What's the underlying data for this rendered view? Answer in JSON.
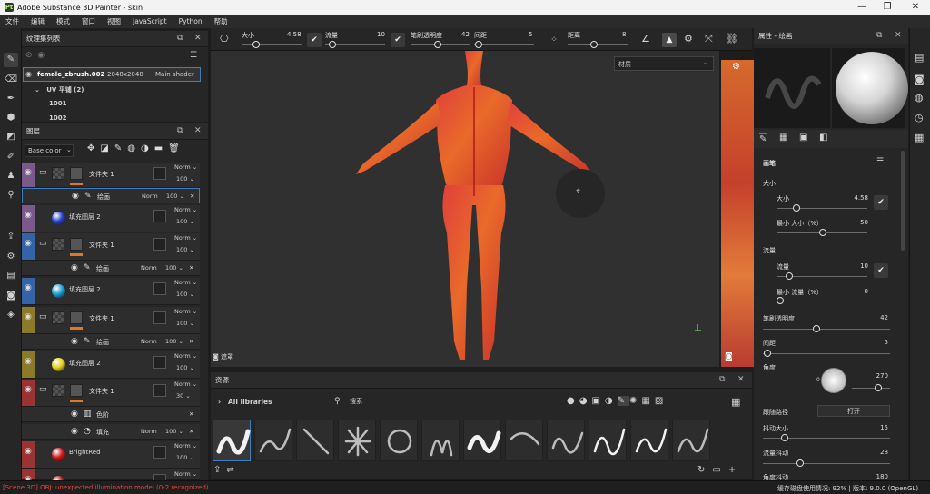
{
  "app": {
    "title": "Adobe Substance 3D Painter - skin"
  },
  "menu": [
    "文件",
    "编辑",
    "模式",
    "窗口",
    "视图",
    "JavaScript",
    "Python",
    "帮助"
  ],
  "texture_set": {
    "title": "纹理集列表",
    "item_name": "female_zbrush.002",
    "item_res": "2048x2048",
    "item_shader": "Main shader",
    "uv_label": "UV 平铺 (2)",
    "uv_tiles": [
      "1001",
      "1002"
    ]
  },
  "layers_panel": {
    "title": "图层",
    "channel": "Base color",
    "layers": [
      {
        "name": "文件夹 1",
        "blend": "Norm",
        "opacity": "100",
        "strip": "#7a5a8a",
        "type": "folder"
      },
      {
        "name": "绘画",
        "blend": "Norm",
        "opacity": "100",
        "type": "paint"
      },
      {
        "name": "填充图层 2",
        "blend": "Norm",
        "opacity": "100",
        "strip": "#7a5a8a",
        "type": "fill",
        "ball": "#2540c8"
      },
      {
        "name": "文件夹 1",
        "blend": "Norm",
        "opacity": "100",
        "strip": "#3563a8",
        "type": "folder"
      },
      {
        "name": "绘画",
        "blend": "Norm",
        "opacity": "100",
        "type": "paint"
      },
      {
        "name": "填充图层 2",
        "blend": "Norm",
        "opacity": "100",
        "strip": "#3563a8",
        "type": "fill",
        "ball": "#1aa0d8"
      },
      {
        "name": "文件夹 1",
        "blend": "Norm",
        "opacity": "100",
        "strip": "#8a7a2a",
        "type": "folder"
      },
      {
        "name": "绘画",
        "blend": "Norm",
        "opacity": "100",
        "type": "paint"
      },
      {
        "name": "填充图层 2",
        "blend": "Norm",
        "opacity": "100",
        "strip": "#8a7a2a",
        "type": "fill",
        "ball": "#e6d21a"
      },
      {
        "name": "文件夹 1",
        "blend": "Norm",
        "opacity": "30",
        "strip": "#9a3434",
        "type": "folder"
      },
      {
        "name": "色阶",
        "blend": "",
        "opacity": "",
        "type": "levels"
      },
      {
        "name": "填充",
        "blend": "Norm",
        "opacity": "100",
        "type": "fillsub"
      },
      {
        "name": "BrightRed",
        "blend": "Norm",
        "opacity": "100",
        "strip": "#9a3434",
        "type": "fill",
        "ball": "#d21818"
      },
      {
        "name": "",
        "blend": "Norm",
        "opacity": "",
        "strip": "#9a3434",
        "type": "fill",
        "ball": "#c01010"
      }
    ]
  },
  "context_bar": {
    "size_label": "大小",
    "size_val": "4.58",
    "flow_label": "流量",
    "flow_val": "10",
    "opacity_label": "笔刷透明度",
    "opacity_val": "42",
    "spacing_label": "间距",
    "spacing_val": "5",
    "distance_label": "距离",
    "distance_val": "8"
  },
  "viewport": {
    "material_select": "材质",
    "hint": "遮罩",
    "hint_icon": "camera-icon"
  },
  "assets": {
    "title": "资源",
    "library": "All libraries",
    "search_placeholder": "搜索"
  },
  "properties": {
    "title": "属性 - 绘画",
    "section": "画笔",
    "size_group": "大小",
    "size_label": "大小",
    "size_val": "4.58",
    "minsize_label": "最小 大小（%）",
    "minsize_val": "50",
    "flow_group": "流量",
    "flow_label": "流量",
    "flow_val": "10",
    "minflow_label": "最小 流量（%）",
    "minflow_val": "0",
    "opacity_label": "笔刷透明度",
    "opacity_val": "42",
    "spacing_label": "间距",
    "spacing_val": "5",
    "angle_label": "角度",
    "angle_val": "270",
    "angle_zero": "0",
    "follow_label": "跟随路径",
    "follow_val": "打开",
    "jitter_size_label": "抖动大小",
    "jitter_size_val": "15",
    "flow_jitter_label": "流量抖动",
    "flow_jitter_val": "28",
    "angle_jitter_label": "角度抖动",
    "angle_jitter_val": "180"
  },
  "status": {
    "error": "[Scene 3D] OBJ: unexpected illumination model (0-2 recognized)",
    "right": "缓存磁盘使用情况:  92%  |  版本: 9.0.0 (OpenGL)"
  }
}
